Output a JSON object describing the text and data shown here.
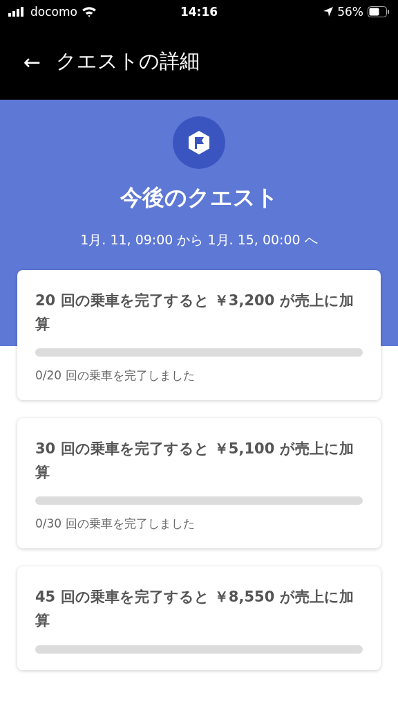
{
  "status_bar": {
    "carrier": "docomo",
    "time": "14:16",
    "battery": "56%"
  },
  "header": {
    "back": "←",
    "title": "クエストの詳細"
  },
  "hero": {
    "title": "今後のクエスト",
    "period": "1月. 11, 09:00 から 1月. 15, 00:00 へ"
  },
  "quests": [
    {
      "title": "20 回の乗車を完了すると ￥3,200 が売上に加算",
      "level": 0,
      "progress": "0/20 回の乗車を完了しました"
    },
    {
      "title": "30 回の乗車を完了すると ￥5,100 が売上に加算",
      "level": 0,
      "progress": "0/30 回の乗車を完了しました"
    },
    {
      "title": "45 回の乗車を完了すると ￥8,550 が売上に加算",
      "level": 0
    }
  ]
}
